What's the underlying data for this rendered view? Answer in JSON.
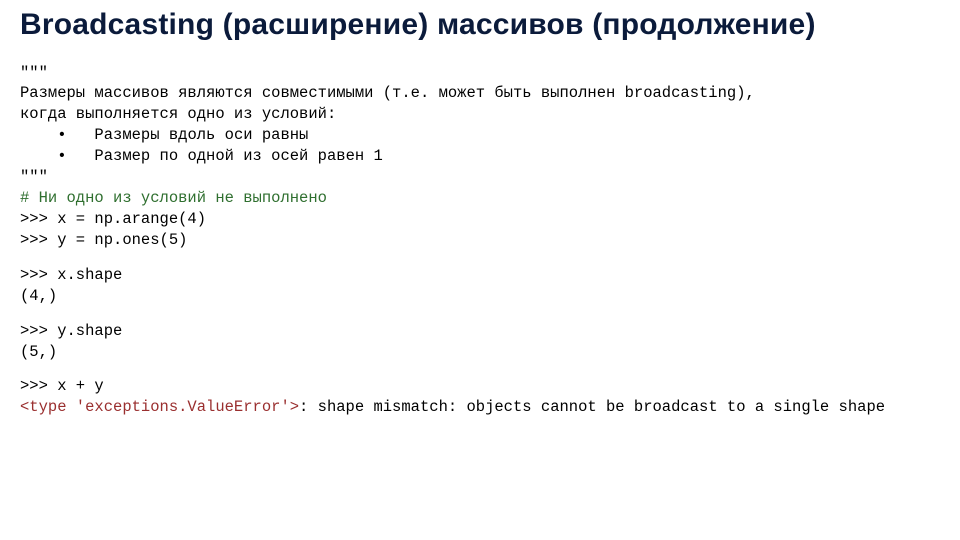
{
  "title": "Broadcasting (расширение) массивов (продолжение)",
  "docstring_open": "\"\"\"",
  "desc_line1": "Размеры массивов являются совместимыми (т.е. может быть выполнен broadcasting),",
  "desc_line2": "когда выполняется одно из условий:",
  "bullet1": "    •   Размеры вдоль оси равны",
  "bullet2": "    •   Размер по одной из осей равен 1",
  "docstring_close": "\"\"\"",
  "comment1": "# Ни одно из условий не выполнено",
  "line_x_assign": ">>> x = np.arange(4)",
  "line_y_assign": ">>> y = np.ones(5)",
  "line_x_shape": ">>> x.shape",
  "out_x_shape": "(4,)",
  "line_y_shape": ">>> y.shape",
  "out_y_shape": "(5,)",
  "line_sum": ">>> x + y",
  "err_type": "<type 'exceptions.ValueError'>",
  "err_msg": ": shape mismatch: objects cannot be broadcast to a single shape"
}
